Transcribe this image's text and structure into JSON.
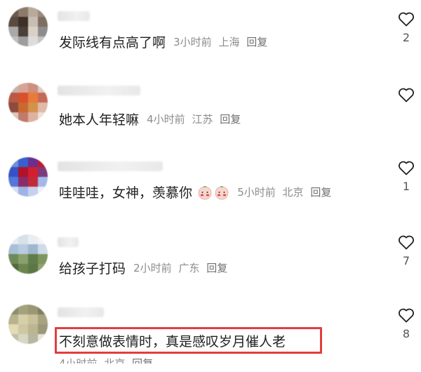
{
  "comments": [
    {
      "text": "发际线有点高了啊",
      "time": "3小时前",
      "location": "上海",
      "reply_label": "回复",
      "likes": "2",
      "avatar_colors": [
        "#6a5a4e",
        "#8c7b6b",
        "#b7aa9b",
        "#9a8b7c",
        "#5a4b40",
        "#3e2f27",
        "#c8bdb0",
        "#7d6e60",
        "#a9a9a9",
        "#4a4038",
        "#d9d1c6",
        "#8d8d8d",
        "#bfbfbf",
        "#9e9e9e",
        "#dcdcdc",
        "#c4c4c4"
      ]
    },
    {
      "text": "她本人年轻嘛",
      "time": "4小时前",
      "location": "江苏",
      "reply_label": "回复",
      "likes": "",
      "avatar_colors": [
        "#c9b3a9",
        "#d6a497",
        "#cf8f7f",
        "#e0c9c0",
        "#b85a45",
        "#d9502f",
        "#e87a3c",
        "#c46a57",
        "#8e4a3d",
        "#c9682f",
        "#d3924c",
        "#e1b9a9",
        "#dcc7be",
        "#c27a6a",
        "#e0b0a0",
        "#efe0d8"
      ]
    },
    {
      "text": "哇哇哇，女神，羡慕你",
      "time": "5小时前",
      "location": "北京",
      "reply_label": "回复",
      "likes": "1",
      "avatar_colors": [
        "#6f8fd8",
        "#3a5fcf",
        "#6a2f8f",
        "#c0182c",
        "#3652c8",
        "#b0122a",
        "#d11f2f",
        "#7d3a7a",
        "#5577d8",
        "#8a2c6a",
        "#c22a3a",
        "#a3b8e8",
        "#d8def2",
        "#9fb3e4",
        "#c7d1ee",
        "#eef1fa"
      ],
      "emoji_count": 2
    },
    {
      "text": "给孩子打码",
      "time": "2小时前",
      "location": "广东",
      "reply_label": "回复",
      "likes": "7",
      "avatar_colors": [
        "#e7ecf1",
        "#d8e1ea",
        "#e9eef3",
        "#f2f4f7",
        "#a8bfd6",
        "#b9cbe0",
        "#9fb6cf",
        "#cfdbe8",
        "#6f8a5a",
        "#8aa06e",
        "#5f7c4a",
        "#7e955f",
        "#4f6b3a",
        "#6d8650",
        "#5c7745",
        "#8fa370"
      ]
    },
    {
      "text": "不刻意做表情时，真是感叹岁月催人老",
      "time": "4小时前",
      "location": "北京",
      "reply_label": "回复",
      "likes": "8",
      "avatar_colors": [
        "#8c8e6e",
        "#a3a27f",
        "#9a9774",
        "#7e7f60",
        "#b9b28d",
        "#d6cfa8",
        "#c9c19a",
        "#a9a37f",
        "#e3dbb5",
        "#cfc7a1",
        "#bcb592",
        "#9b9878",
        "#c1c0a8",
        "#d8d7c4",
        "#b7b6a0",
        "#e6e5d8"
      ]
    }
  ],
  "colors": {
    "highlight_border": "#e33d3d",
    "emoji_face": "#f8d6cf",
    "emoji_cheek": "#e9413f"
  }
}
